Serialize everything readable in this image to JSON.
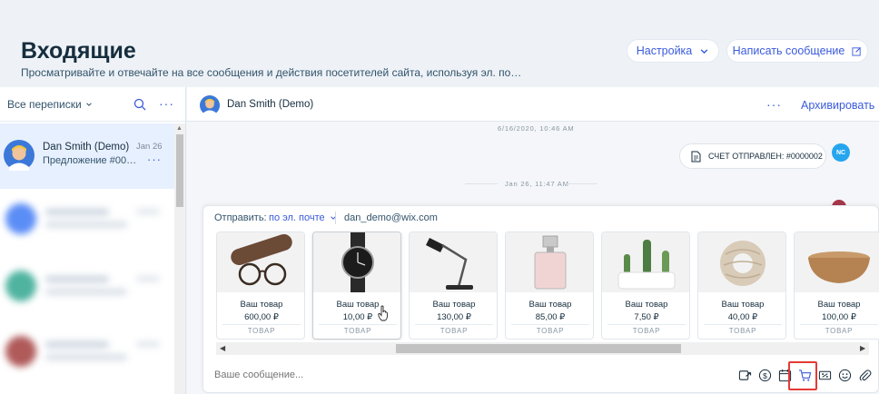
{
  "header": {
    "title": "Входящие",
    "subtitle": "Просматривайте и отвечайте на все сообщения и действия посетителей сайта, используя эл. по…",
    "settings_label": "Настройка",
    "write_label": "Написать сообщение"
  },
  "sidebar": {
    "filter_label": "Все переписки",
    "active_conversation": {
      "name": "Dan Smith (Demo)",
      "date": "Jan 26",
      "preview": "Предложение #00…"
    }
  },
  "chat": {
    "contact_name": "Dan Smith (Demo)",
    "archive_label": "Архивировать",
    "timestamp_1": "6/16/2020, 10:46 AM",
    "timestamp_2": "Jan 26, 11:47 AM",
    "invoice_label": "СЧЕТ ОТПРАВЛЕН: #0000002",
    "agent_badge": "NC"
  },
  "composer": {
    "send_label": "Отправить:",
    "send_method": "по эл. почте",
    "send_email": "dan_demo@wix.com",
    "message_placeholder": "Ваше сообщение...",
    "products": [
      {
        "name": "Ваш товар",
        "price": "600,00 ₽",
        "type": "ТОВАР",
        "image": "glasses-image"
      },
      {
        "name": "Ваш товар",
        "price": "10,00 ₽",
        "type": "ТОВАР",
        "image": "watch-image"
      },
      {
        "name": "Ваш товар",
        "price": "130,00 ₽",
        "type": "ТОВАР",
        "image": "desk-lamp-image"
      },
      {
        "name": "Ваш товар",
        "price": "85,00 ₽",
        "type": "ТОВАР",
        "image": "perfume-image"
      },
      {
        "name": "Ваш товар",
        "price": "7,50 ₽",
        "type": "ТОВАР",
        "image": "cactus-image"
      },
      {
        "name": "Ваш товар",
        "price": "40,00 ₽",
        "type": "ТОВАР",
        "image": "scarf-image"
      },
      {
        "name": "Ваш товар",
        "price": "100,00 ₽",
        "type": "ТОВАР",
        "image": "bowl-image"
      }
    ]
  },
  "colors": {
    "accent": "#3b5bdb",
    "active_row": "#e7f0ff",
    "highlight": "#e53935",
    "badge": "#26a5ef"
  }
}
